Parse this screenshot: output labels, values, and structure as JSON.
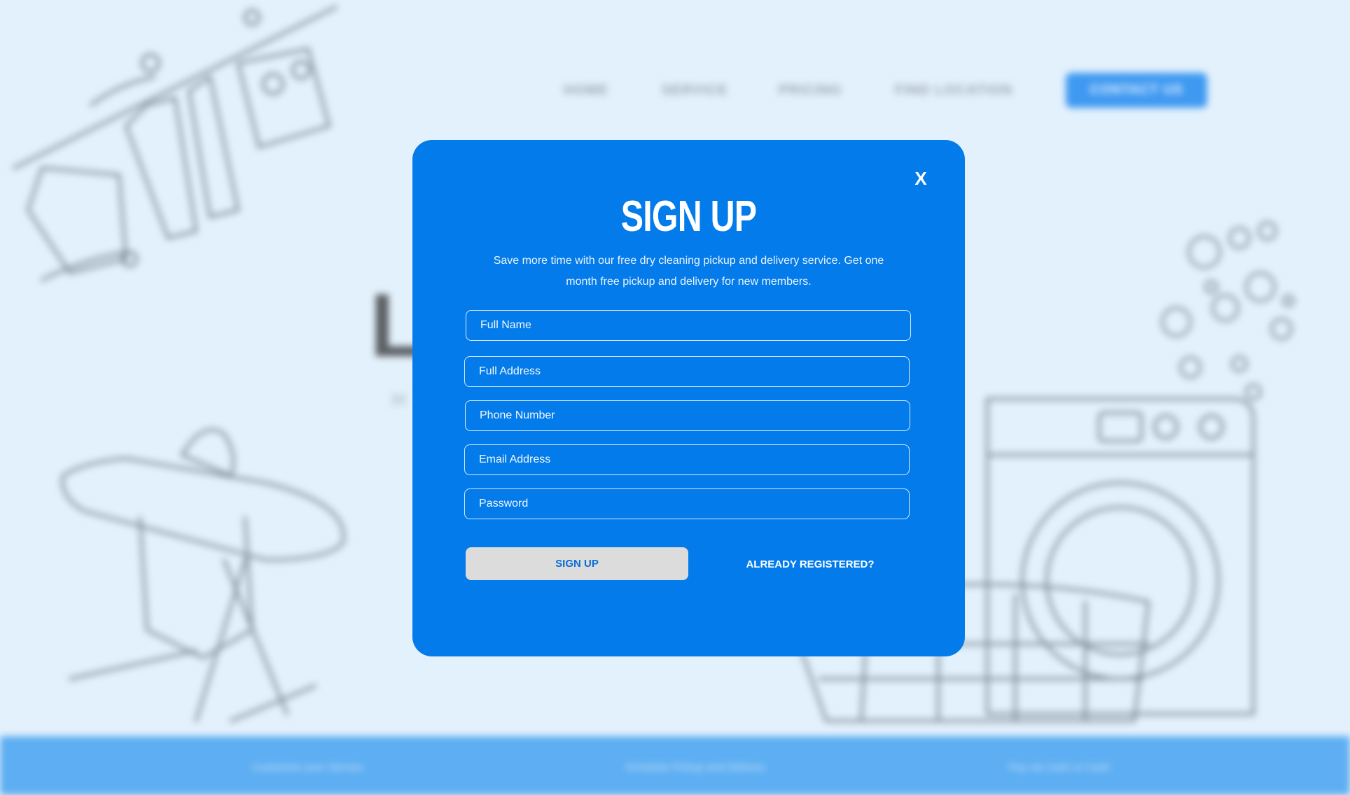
{
  "nav": {
    "links": [
      "HOME",
      "SERVICE",
      "PRICING",
      "FIND LOCATION"
    ],
    "contact_label": "CONTACT US"
  },
  "hero": {
    "title": "LA",
    "subtitle": "H"
  },
  "footer": {
    "items": [
      "Customize your Service",
      "Schedule Pickup and Delivery",
      "Pay via Cash or Cash"
    ]
  },
  "modal": {
    "close_label": "X",
    "title": "SIGN UP",
    "description": "Save more time with our free dry cleaning pickup and delivery service. Get one month free pickup and delivery for new members.",
    "fields": {
      "full_name_placeholder": "Full Name",
      "full_address_placeholder": "Full Address",
      "phone_placeholder": "Phone Number",
      "email_placeholder": "Email Address",
      "password_placeholder": "Password"
    },
    "signup_label": "SIGN UP",
    "login_label": "ALREADY REGISTERED?"
  },
  "colors": {
    "background": "#e3f1fc",
    "modal": "#037bea",
    "footer": "#5daef2",
    "button": "#dcdcdc",
    "accent": "#3f99f1"
  },
  "icons": [
    "clothesline-illustration",
    "ironing-board-illustration",
    "washing-machine-illustration",
    "bubbles-illustration",
    "close-icon"
  ]
}
